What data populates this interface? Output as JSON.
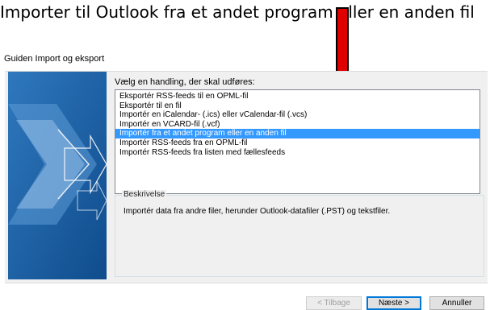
{
  "instruction": "Importer til Outlook fra et andet program eller en anden fil",
  "window": {
    "title": "Guiden Import og eksport"
  },
  "dialog": {
    "prompt": "Vælg en handling, der skal udføres:",
    "actions": [
      {
        "label": "Eksportér RSS-feeds til en OPML-fil",
        "selected": false
      },
      {
        "label": "Eksportér til en fil",
        "selected": false
      },
      {
        "label": "Importér en iCalendar- (.ics) eller vCalendar-fil (.vcs)",
        "selected": false
      },
      {
        "label": "Importér en VCARD-fil (.vcf)",
        "selected": false
      },
      {
        "label": "Importér fra et andet program eller en anden fil",
        "selected": true
      },
      {
        "label": "Importér RSS-feeds fra en OPML-fil",
        "selected": false
      },
      {
        "label": "Importér RSS-feeds fra listen med fællesfeeds",
        "selected": false
      }
    ],
    "description_group_label": "Beskrivelse",
    "description": "Importér data fra andre filer, herunder Outlook-datafiler (.PST) og tekstfiler."
  },
  "buttons": {
    "back": "< Tilbage",
    "next": "Næste >",
    "cancel": "Annuller"
  },
  "colors": {
    "arrow": "#e10000",
    "selection": "#3399ff",
    "art_blue": "#1f5f9f"
  }
}
